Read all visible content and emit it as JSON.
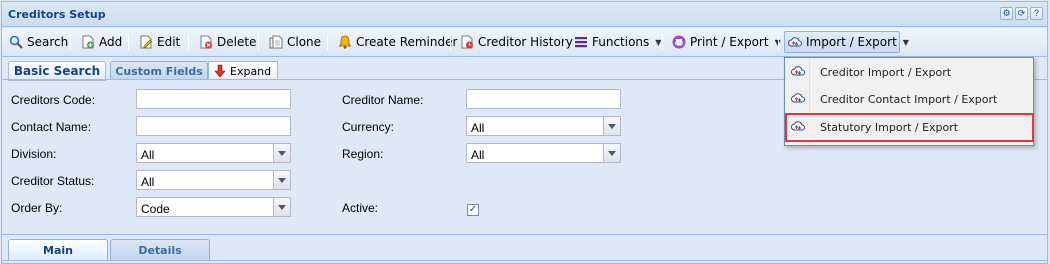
{
  "panel": {
    "title": "Creditors Setup",
    "tools": [
      "gear-icon",
      "refresh-icon",
      "help-icon"
    ],
    "tool_glyphs": [
      "⚙",
      "⟳",
      "?"
    ]
  },
  "toolbar": {
    "search": "Search",
    "add": "Add",
    "edit": "Edit",
    "delete": "Delete",
    "clone": "Clone",
    "create_reminder": "Create Reminder",
    "creditor_history": "Creditor History",
    "functions": "Functions",
    "print_export": "Print / Export",
    "import_export": "Import / Export"
  },
  "tabs": {
    "basic_search": "Basic Search",
    "custom_fields": "Custom Fields",
    "expand": "Expand"
  },
  "form": {
    "creditors_code": {
      "label": "Creditors Code:",
      "value": ""
    },
    "creditor_name": {
      "label": "Creditor Name:",
      "value": ""
    },
    "contact_name": {
      "label": "Contact Name:",
      "value": ""
    },
    "currency": {
      "label": "Currency:",
      "value": "All"
    },
    "division": {
      "label": "Division:",
      "value": "All"
    },
    "region": {
      "label": "Region:",
      "value": "All"
    },
    "creditor_status": {
      "label": "Creditor Status:",
      "value": "All"
    },
    "order_by": {
      "label": "Order By:",
      "value": "Code"
    },
    "active": {
      "label": "Active:",
      "checked": true,
      "mark": "✓"
    }
  },
  "bottom_tabs": {
    "main": "Main",
    "details": "Details"
  },
  "import_menu": {
    "items": [
      {
        "label": "Creditor Import / Export"
      },
      {
        "label": "Creditor Contact Import / Export"
      },
      {
        "label": "Statutory Import / Export"
      }
    ]
  },
  "colors": {
    "accent": "#15428b",
    "highlight_border": "#e0393e",
    "panel_bg": "#dfe8f6"
  }
}
